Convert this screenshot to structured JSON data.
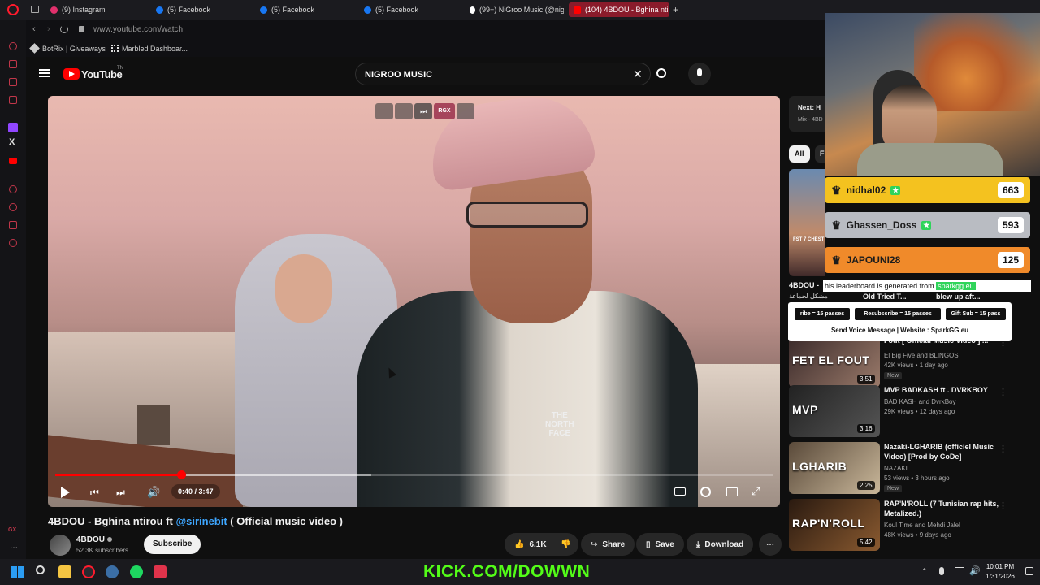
{
  "browser": {
    "tabs": [
      {
        "label": "(9) Instagram",
        "color": "#e1306c"
      },
      {
        "label": "(5) Facebook",
        "color": "#1877f2"
      },
      {
        "label": "(5) Facebook",
        "color": "#1877f2"
      },
      {
        "label": "(5) Facebook",
        "color": "#1877f2"
      },
      {
        "label": "(99+) NiGroo Music (@nig",
        "color": "#ffffff"
      },
      {
        "label": "(104) 4BDOU - Bghina ntir",
        "color": "#ff0000",
        "active": true
      }
    ],
    "new_tab": "+",
    "url": "www.youtube.com/watch",
    "bookmarks": [
      "BotRix | Giveaways",
      "Marbled Dashboar..."
    ]
  },
  "youtube": {
    "logo": "YouTube",
    "logo_sup": "TN",
    "search_value": "NIGROO MUSIC",
    "player": {
      "time": "0:40 / 3:47",
      "progress_percent": 17.6,
      "buffer_percent": 44,
      "overlay_label": "RGX"
    },
    "video": {
      "title_prefix": "4BDOU - Bghina ntirou ft ",
      "title_mention": "@sirinebit",
      "title_suffix": " ( Official music video )",
      "channel": "4BDOU",
      "subscribers": "52.3K subscribers",
      "subscribe_label": "Subscribe",
      "likes": "6.1K",
      "share": "Share",
      "save": "Save",
      "download": "Download"
    },
    "next": {
      "label": "Next: H",
      "sub": "Mix - 4BD"
    },
    "chips": [
      "All",
      "F"
    ],
    "recommended_partial": {
      "title": "4BDOU -",
      "sub": "مشكل لجماعة",
      "thumb_text": "FST 7 CHEST"
    },
    "behind_overlay": [
      "Old Tried T...",
      "blew up aft..."
    ],
    "recommended": [
      {
        "title": "Fout [ Official Music Video ] ...",
        "channel": "El Big Five and BLINGOS",
        "meta": "42K views • 1 day ago",
        "badge": "New",
        "duration": "3:51",
        "thumb_text": "FET EL FOUT",
        "colors": [
          "#3a2a2a",
          "#9a7a6a"
        ]
      },
      {
        "title": "MVP  BADKASH ft . DVRKBOY",
        "channel": "BAD KASH and DvrkBoy",
        "meta": "29K views • 12 days ago",
        "badge": "",
        "duration": "3:16",
        "thumb_text": "MVP",
        "colors": [
          "#222222",
          "#555555"
        ]
      },
      {
        "title": "Nazaki-LGHARIB (officiel Music Video) [Prod by CoDe]",
        "channel": "NAZAKI",
        "meta": "53 views • 3 hours ago",
        "badge": "New",
        "duration": "2:25",
        "thumb_text": "LGHARIB",
        "colors": [
          "#5a4a3a",
          "#c9b79a"
        ]
      },
      {
        "title": "RAP'N'ROLL (7 Tunisian rap hits, Metalized.)",
        "channel": "Koul Time and Mehdi Jalel",
        "meta": "48K views • 9 days ago",
        "badge": "",
        "duration": "5:42",
        "thumb_text": "RAP'N'ROLL",
        "colors": [
          "#2a1a10",
          "#8a5a30"
        ]
      }
    ]
  },
  "stream_overlay": {
    "leaderboard": [
      {
        "name": "nidhal02",
        "score": "663",
        "color": "#f4c21f"
      },
      {
        "name": "Ghassen_Doss",
        "score": "593",
        "color": "#b9bcc2"
      },
      {
        "name": "JAPOUNI28",
        "score": "125",
        "color": "#f08a2a"
      }
    ],
    "generated_prefix": "his leaderboard is generated from ",
    "generated_site": "sparkgg.eu",
    "passes": [
      "ribe = 15 passes",
      "Resubscribe = 15 passes",
      "Gift Sub = 15 pass"
    ],
    "voice_line": "Send Voice Message | Website : SparkGG.eu",
    "kick_banner": "KICK.COM/DOWWN"
  },
  "taskbar": {
    "time": "10:01 PM",
    "date": "1/31/2026"
  }
}
